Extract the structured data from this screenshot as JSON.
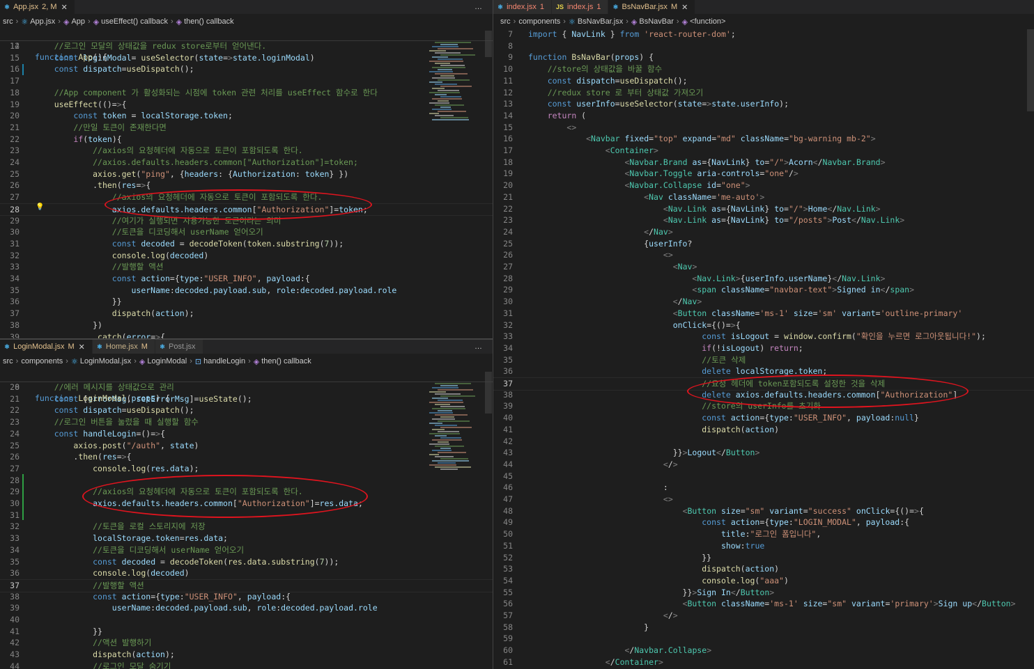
{
  "panes": {
    "app": {
      "tabs": [
        {
          "name": "App.jsx",
          "icon": "react-file-icon",
          "badge": "2, M",
          "badge_class": "mod",
          "active": true,
          "close": true
        },
        {
          "name": "",
          "icon": "",
          "badge": "",
          "badge_class": "",
          "active": false,
          "close": false
        }
      ],
      "breadcrumbs": [
        "src",
        "App.jsx",
        "App",
        "useEffect() callback",
        "then() callback"
      ],
      "sticky": {
        "n": "12",
        "code": "function App(){"
      },
      "lines": [
        {
          "n": "14",
          "code": "    //로그인 모달의 상태값을 redux store로부터 얻어낸다."
        },
        {
          "n": "15",
          "code": "    const loginModal= useSelector(state=>state.loginModal)"
        },
        {
          "n": "16",
          "code": "    const dispatch=useDispatch();"
        },
        {
          "n": "17",
          "code": ""
        },
        {
          "n": "18",
          "code": "    //App component 가 활성화되는 시점에 token 관련 처리를 useEffect 함수로 한다"
        },
        {
          "n": "19",
          "code": "    useEffect(()=>{"
        },
        {
          "n": "20",
          "code": "        const token = localStorage.token;"
        },
        {
          "n": "21",
          "code": "        //만일 토큰이 존재한다면"
        },
        {
          "n": "22",
          "code": "        if(token){"
        },
        {
          "n": "23",
          "code": "            //axios의 요청헤더에 자동으로 토큰이 포함되도록 한다."
        },
        {
          "n": "24",
          "code": "            //axios.defaults.headers.common[\"Authorization\"]=token;"
        },
        {
          "n": "25",
          "code": "            axios.get(\"ping\", {headers: {Authorization: token} })"
        },
        {
          "n": "26",
          "code": "            .then(res=>{"
        },
        {
          "n": "27",
          "code": "                //axios의 요청헤더에 자동으로 토큰이 포함되도록 한다."
        },
        {
          "n": "28",
          "code": "                axios.defaults.headers.common[\"Authorization\"]=token;"
        },
        {
          "n": "29",
          "code": "                //여기가 실행되면 사용가능한 토큰이라는 의미"
        },
        {
          "n": "30",
          "code": "                //토큰을 디코딩해서 userName 얻어오기"
        },
        {
          "n": "31",
          "code": "                const decoded = decodeToken(token.substring(7));"
        },
        {
          "n": "32",
          "code": "                console.log(decoded)"
        },
        {
          "n": "33",
          "code": "                //발행할 액션"
        },
        {
          "n": "34",
          "code": "                const action={type:\"USER_INFO\", payload:{"
        },
        {
          "n": "35",
          "code": "                    userName:decoded.payload.sub, role:decoded.payload.role"
        },
        {
          "n": "36",
          "code": "                }}"
        },
        {
          "n": "37",
          "code": "                dispatch(action);"
        },
        {
          "n": "38",
          "code": "            })"
        },
        {
          "n": "39",
          "code": "            .catch(error=>{"
        }
      ]
    },
    "login": {
      "tabs": [
        {
          "name": "LoginModal.jsx",
          "icon": "react-file-icon",
          "badge": "M",
          "badge_class": "mod",
          "active": true,
          "close": true
        },
        {
          "name": "Home.jsx",
          "icon": "react-file-icon",
          "badge": "M",
          "badge_class": "mod",
          "active": false,
          "close": false
        },
        {
          "name": "Post.jsx",
          "icon": "react-file-icon",
          "badge": "",
          "badge_class": "",
          "active": false,
          "close": false
        }
      ],
      "breadcrumbs": [
        "src",
        "components",
        "LoginModal.jsx",
        "LoginModal",
        "handleLogin",
        "then() callback"
      ],
      "sticky": {
        "n": "8",
        "code": "function LoginModal(props) {"
      },
      "lines": [
        {
          "n": "20",
          "code": "    //에러 메시지를 상태값으로 관리"
        },
        {
          "n": "21",
          "code": "    const [errorMsg, setErrorMsg]=useState();"
        },
        {
          "n": "22",
          "code": "    const dispatch=useDispatch();"
        },
        {
          "n": "23",
          "code": "    //로그인 버튼을 눌렀을 때 실행할 함수"
        },
        {
          "n": "24",
          "code": "    const handleLogin=()=>{"
        },
        {
          "n": "25",
          "code": "        axios.post(\"/auth\", state)"
        },
        {
          "n": "26",
          "code": "        .then(res=>{"
        },
        {
          "n": "27",
          "code": "            console.log(res.data);"
        },
        {
          "n": "28",
          "code": ""
        },
        {
          "n": "29",
          "code": "            //axios의 요청헤더에 자동으로 토큰이 포함되도록 한다."
        },
        {
          "n": "30",
          "code": "            axios.defaults.headers.common[\"Authorization\"]=res.data;"
        },
        {
          "n": "31",
          "code": ""
        },
        {
          "n": "32",
          "code": "            //토큰을 로컬 스토리지에 저장"
        },
        {
          "n": "33",
          "code": "            localStorage.token=res.data;"
        },
        {
          "n": "34",
          "code": "            //토큰을 디코딩해서 userName 얻어오기"
        },
        {
          "n": "35",
          "code": "            const decoded = decodeToken(res.data.substring(7));"
        },
        {
          "n": "36",
          "code": "            console.log(decoded)"
        },
        {
          "n": "37",
          "code": "            //발행할 액션"
        },
        {
          "n": "38",
          "code": "            const action={type:\"USER_INFO\", payload:{"
        },
        {
          "n": "39",
          "code": "                userName:decoded.payload.sub, role:decoded.payload.role"
        },
        {
          "n": "40",
          "code": ""
        },
        {
          "n": "41",
          "code": "            }}"
        },
        {
          "n": "42",
          "code": "            //액션 발행하기"
        },
        {
          "n": "43",
          "code": "            dispatch(action);"
        },
        {
          "n": "44",
          "code": "            //로그인 모달 숨기기"
        }
      ]
    },
    "navbar": {
      "tabs": [
        {
          "name": "index.jsx",
          "icon": "react-file-icon",
          "badge": "1",
          "badge_class": "err",
          "active": false,
          "close": false
        },
        {
          "name": "index.js",
          "icon": "js-file-icon",
          "badge": "1",
          "badge_class": "err",
          "active": false,
          "close": false
        },
        {
          "name": "BsNavBar.jsx",
          "icon": "react-file-icon",
          "badge": "M",
          "badge_class": "mod",
          "active": true,
          "close": true
        }
      ],
      "breadcrumbs": [
        "src",
        "components",
        "BsNavBar.jsx",
        "BsNavBar",
        "<function>"
      ],
      "lines": [
        {
          "n": "7",
          "code": "import { NavLink } from 'react-router-dom';"
        },
        {
          "n": "8",
          "code": ""
        },
        {
          "n": "9",
          "code": "function BsNavBar(props) {"
        },
        {
          "n": "10",
          "code": "    //store의 상태값을 바꿀 함수"
        },
        {
          "n": "11",
          "code": "    const dispatch=useDispatch();"
        },
        {
          "n": "12",
          "code": "    //redux store 로 부터 상태값 가져오기"
        },
        {
          "n": "13",
          "code": "    const userInfo=useSelector(state=>state.userInfo);"
        },
        {
          "n": "14",
          "code": "    return ("
        },
        {
          "n": "15",
          "code": "        <>"
        },
        {
          "n": "16",
          "code": "            <Navbar fixed=\"top\" expand=\"md\" className=\"bg-warning mb-2\">"
        },
        {
          "n": "17",
          "code": "                <Container>"
        },
        {
          "n": "18",
          "code": "                    <Navbar.Brand as={NavLink} to=\"/\">Acorn</Navbar.Brand>"
        },
        {
          "n": "19",
          "code": "                    <Navbar.Toggle aria-controls=\"one\"/>"
        },
        {
          "n": "20",
          "code": "                    <Navbar.Collapse id=\"one\">"
        },
        {
          "n": "21",
          "code": "                        <Nav className='me-auto'>"
        },
        {
          "n": "22",
          "code": "                            <Nav.Link as={NavLink} to=\"/\">Home</Nav.Link>"
        },
        {
          "n": "23",
          "code": "                            <Nav.Link as={NavLink} to=\"/posts\">Post</Nav.Link>"
        },
        {
          "n": "24",
          "code": "                        </Nav>"
        },
        {
          "n": "25",
          "code": "                        {userInfo?"
        },
        {
          "n": "26",
          "code": "                            <>"
        },
        {
          "n": "27",
          "code": "                              <Nav>"
        },
        {
          "n": "28",
          "code": "                                  <Nav.Link>{userInfo.userName}</Nav.Link>"
        },
        {
          "n": "29",
          "code": "                                  <span className=\"navbar-text\">Signed in</span>"
        },
        {
          "n": "30",
          "code": "                              </Nav>"
        },
        {
          "n": "31",
          "code": "                              <Button className='ms-1' size='sm' variant='outline-primary'"
        },
        {
          "n": "32",
          "code": "                              onClick={()=>{"
        },
        {
          "n": "33",
          "code": "                                    const isLogout = window.confirm(\"확인을 누르면 로그아웃됩니다!\");"
        },
        {
          "n": "34",
          "code": "                                    if(!isLogout) return;"
        },
        {
          "n": "35",
          "code": "                                    //토큰 삭제"
        },
        {
          "n": "36",
          "code": "                                    delete localStorage.token;"
        },
        {
          "n": "37",
          "code": "                                    //요청 헤더에 token포함되도록 설정한 것을 삭제"
        },
        {
          "n": "38",
          "code": "                                    delete axios.defaults.headers.common[\"Authorization\"]"
        },
        {
          "n": "39",
          "code": "                                    //store의 userInfo를 초기화"
        },
        {
          "n": "40",
          "code": "                                    const action={type:\"USER_INFO\", payload:null}"
        },
        {
          "n": "41",
          "code": "                                    dispatch(action)"
        },
        {
          "n": "42",
          "code": ""
        },
        {
          "n": "43",
          "code": "                              }}>Logout</Button>"
        },
        {
          "n": "44",
          "code": "                            </>"
        },
        {
          "n": "45",
          "code": ""
        },
        {
          "n": "46",
          "code": "                            :"
        },
        {
          "n": "47",
          "code": "                            <>"
        },
        {
          "n": "48",
          "code": "                                <Button size=\"sm\" variant=\"success\" onClick={()=>{"
        },
        {
          "n": "49",
          "code": "                                    const action={type:\"LOGIN_MODAL\", payload:{"
        },
        {
          "n": "50",
          "code": "                                        title:\"로그인 폼입니다\","
        },
        {
          "n": "51",
          "code": "                                        show:true"
        },
        {
          "n": "52",
          "code": "                                    }}"
        },
        {
          "n": "53",
          "code": "                                    dispatch(action)"
        },
        {
          "n": "54",
          "code": "                                    console.log(\"aaa\")"
        },
        {
          "n": "55",
          "code": "                                }}>Sign In</Button>"
        },
        {
          "n": "56",
          "code": "                                <Button className='ms-1' size=\"sm\" variant='primary'>Sign up</Button>"
        },
        {
          "n": "57",
          "code": "                            </>"
        },
        {
          "n": "58",
          "code": "                        }"
        },
        {
          "n": "59",
          "code": ""
        },
        {
          "n": "60",
          "code": "                    </Navbar.Collapse>"
        },
        {
          "n": "61",
          "code": "                </Container>"
        }
      ]
    }
  },
  "colors": {
    "background": "#1e1e1e",
    "keyword": "#569cd6",
    "control": "#c586c0",
    "string": "#ce9178",
    "comment": "#6a9955",
    "function": "#dcdcaa",
    "variable": "#9cdcfe",
    "component": "#4ec9b0",
    "annotation_circle": "#e0141e"
  },
  "current_lines": {
    "app": "28",
    "login": "37",
    "navbar": "37"
  },
  "more_icon": "…"
}
